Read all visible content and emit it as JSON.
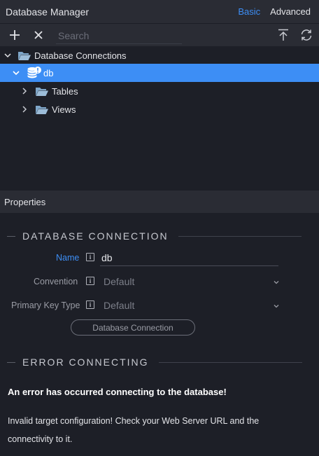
{
  "header": {
    "title": "Database Manager",
    "mode_basic": "Basic",
    "mode_advanced": "Advanced"
  },
  "toolbar": {
    "add_icon": "plus-icon",
    "remove_icon": "close-icon",
    "search_placeholder": "Search",
    "export_icon": "upload-icon",
    "refresh_icon": "refresh-icon"
  },
  "tree": {
    "root": {
      "label": "Database Connections",
      "expanded": true
    },
    "connection": {
      "label": "db",
      "expanded": true,
      "selected": true,
      "icon": "database-error-icon"
    },
    "children": [
      {
        "label": "Tables",
        "expanded": false
      },
      {
        "label": "Views",
        "expanded": false
      }
    ]
  },
  "properties": {
    "title": "Properties",
    "section_connection": "DATABASE CONNECTION",
    "fields": {
      "name": {
        "label": "Name",
        "value": "db"
      },
      "convention": {
        "label": "Convention",
        "value": "Default"
      },
      "primary_key_type": {
        "label": "Primary Key Type",
        "value": "Default"
      }
    },
    "connection_button": "Database Connection",
    "section_error": "ERROR CONNECTING",
    "error_title": "An error has occurred connecting to the database!",
    "error_message": "Invalid target configuration! Check your Web Server URL and the connectivity to it."
  },
  "colors": {
    "accent": "#3d8ef5",
    "panel": "#2a2c34",
    "background": "#1d1f27",
    "folder": "#7ea6c9"
  }
}
